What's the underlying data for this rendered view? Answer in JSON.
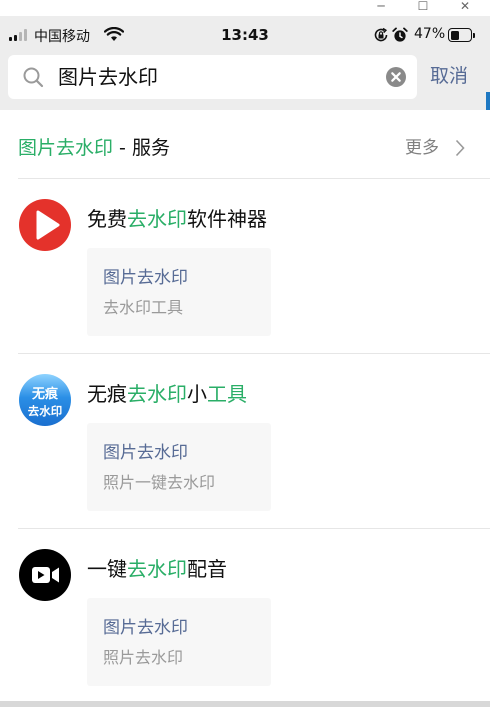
{
  "window": {
    "minimize": "─",
    "maximize": "☐",
    "close": "✕"
  },
  "status_bar": {
    "carrier": "中国移动",
    "time": "13:43",
    "battery_percent": "47%",
    "battery_level": 0.47
  },
  "search": {
    "query": "图片去水印",
    "cancel_label": "取消"
  },
  "section": {
    "title_highlight": "图片去水印",
    "title_rest": " - 服务",
    "more_label": "更多"
  },
  "results": [
    {
      "icon": "red-play-icon",
      "title_parts": [
        "免费",
        "去水印",
        "软件神器"
      ],
      "card_title": "图片去水印",
      "card_subtitle": "去水印工具"
    },
    {
      "icon": "wuhen-logo",
      "logo_text": [
        "无痕",
        "去水印"
      ],
      "title_parts": [
        "无痕",
        "去水印",
        "小",
        "工具"
      ],
      "card_title": "图片去水印",
      "card_subtitle": "照片一键去水印"
    },
    {
      "icon": "video-camera-icon",
      "title_parts": [
        "一键",
        "去水印",
        "配音"
      ],
      "card_title": "图片去水印",
      "card_subtitle": "照片去水印"
    }
  ],
  "colors": {
    "highlight": "#2aae67",
    "link": "#576b95",
    "header_bg": "#ededed",
    "red_icon": "#e4322b",
    "wuhen_blue": "#1a7fd6"
  }
}
